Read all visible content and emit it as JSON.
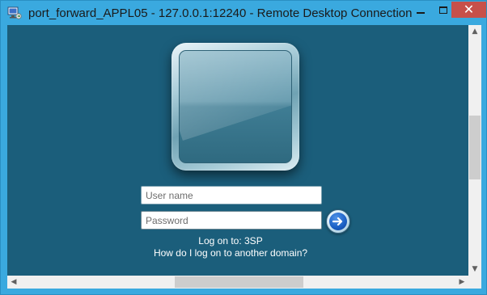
{
  "window": {
    "title": "port_forward_APPL05 - 127.0.0.1:12240 - Remote Desktop Connection",
    "icon": "remote-desktop-icon",
    "close_glyph": "✕"
  },
  "logon": {
    "username_placeholder": "User name",
    "password_placeholder": "Password",
    "logon_to": "Log on to: 3SP",
    "other_domain_link": "How do I log on to another domain?"
  },
  "colors": {
    "frame": "#3aa9df",
    "desktop_background": "#1b5e7b",
    "close_button": "#c7504a"
  },
  "scrollbars": {
    "up_glyph": "▲",
    "down_glyph": "▼",
    "left_glyph": "◀",
    "right_glyph": "▶"
  }
}
